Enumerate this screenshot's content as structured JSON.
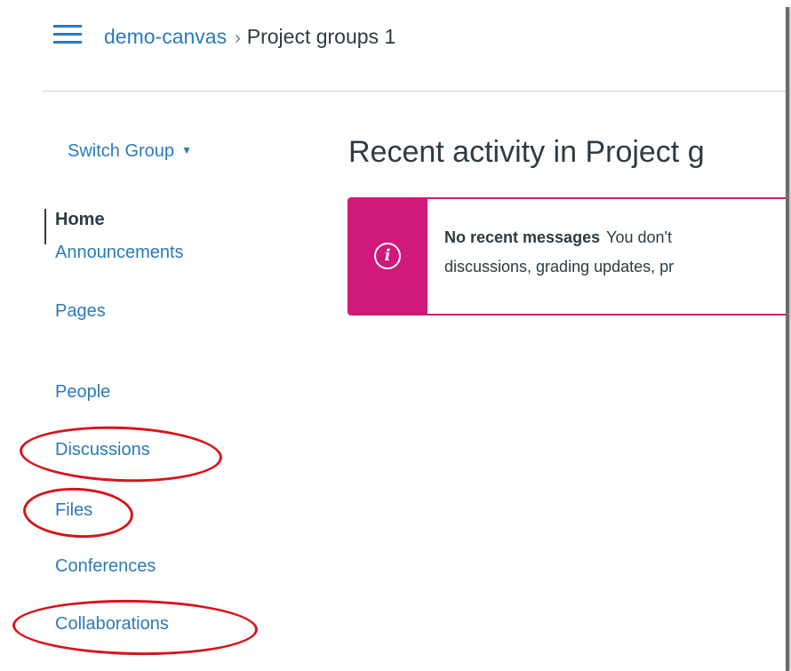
{
  "header": {
    "breadcrumb": {
      "root": "demo-canvas",
      "separator": "›",
      "current": "Project groups 1"
    }
  },
  "sidebar": {
    "switch_group": {
      "label": "Switch Group",
      "caret": "▼"
    },
    "items": [
      {
        "label": "Home",
        "active": true
      },
      {
        "label": "Announcements"
      },
      {
        "label": "Pages"
      },
      {
        "label": "People"
      },
      {
        "label": "Discussions",
        "highlighted": true
      },
      {
        "label": "Files",
        "highlighted": true
      },
      {
        "label": "Conferences"
      },
      {
        "label": "Collaborations",
        "highlighted": true
      }
    ]
  },
  "main": {
    "title": "Recent activity in Project g",
    "alert": {
      "icon": "i",
      "heading": "No recent messages",
      "line1": "You don't",
      "line2": "discussions, grading updates, pr"
    }
  },
  "colors": {
    "link": "#2b7abc",
    "text": "#2d3b45",
    "alert": "#d0197b",
    "annotation": "#d6151b"
  }
}
